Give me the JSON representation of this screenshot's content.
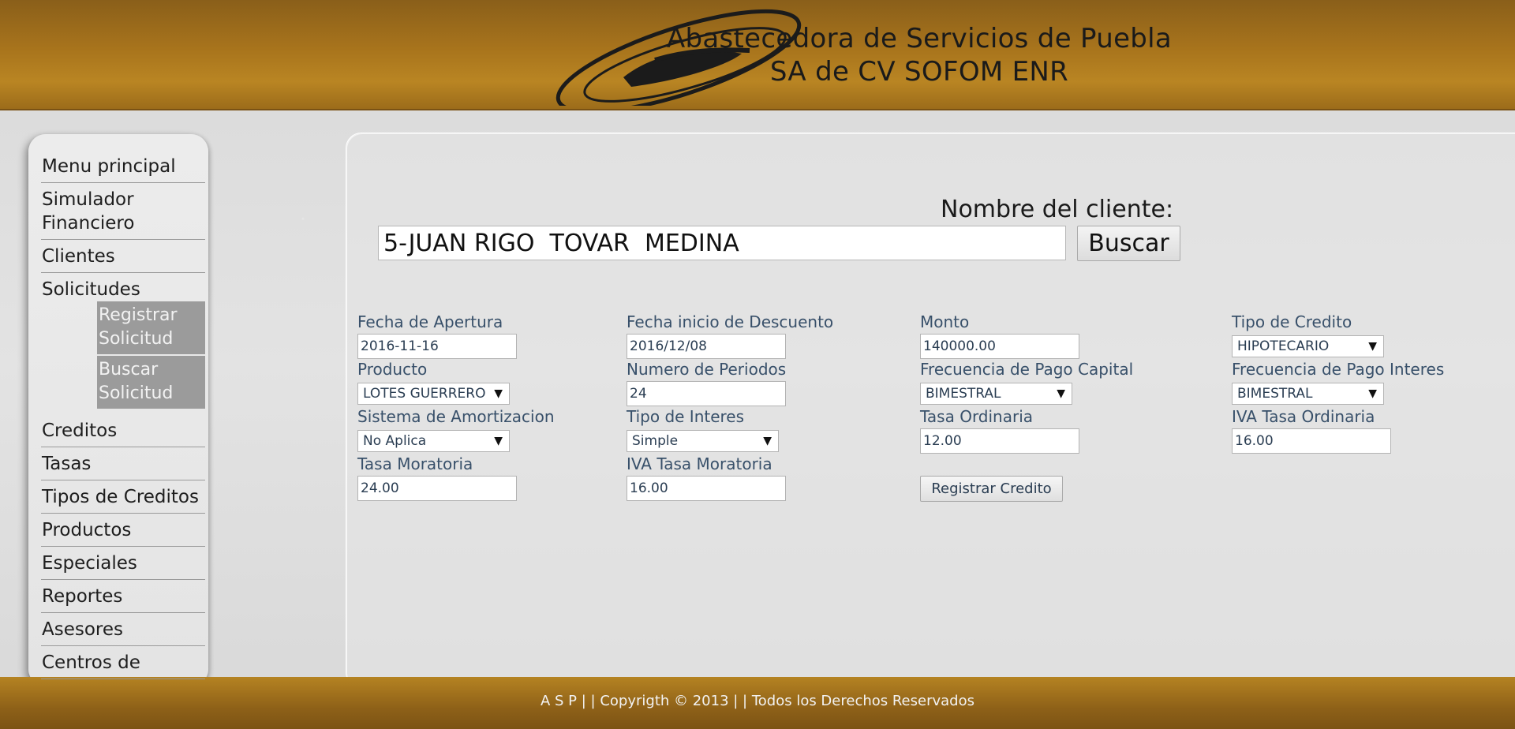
{
  "header": {
    "company_line1": "Abastecedora de Servicios de Puebla",
    "company_line2": "SA de CV SOFOM ENR"
  },
  "sidebar": {
    "items": [
      {
        "label": "Menu principal"
      },
      {
        "label": "Simulador Financiero"
      },
      {
        "label": "Clientes"
      },
      {
        "label": "Solicitudes"
      },
      {
        "label": "Creditos"
      },
      {
        "label": "Tasas"
      },
      {
        "label": "Tipos de Creditos"
      },
      {
        "label": "Productos"
      },
      {
        "label": "Especiales"
      },
      {
        "label": "Reportes"
      },
      {
        "label": "Asesores"
      },
      {
        "label": "Centros de"
      }
    ],
    "subitems": [
      {
        "label": "Registrar Solicitud"
      },
      {
        "label": "Buscar Solicitud"
      }
    ]
  },
  "search": {
    "label": "Nombre del cliente:",
    "value": "5-JUAN RIGO  TOVAR  MEDINA",
    "button_label": "Buscar"
  },
  "form": {
    "fecha_apertura": {
      "label": "Fecha de Apertura",
      "value": "2016-11-16"
    },
    "fecha_inicio": {
      "label": "Fecha inicio de Descuento",
      "value": "2016/12/08"
    },
    "monto": {
      "label": "Monto",
      "value": "140000.00"
    },
    "tipo_credito": {
      "label": "Tipo de Credito",
      "value": "HIPOTECARIO"
    },
    "producto": {
      "label": "Producto",
      "value": "LOTES GUERRERO"
    },
    "numero_periodos": {
      "label": "Numero de Periodos",
      "value": "24"
    },
    "frecuencia_capital": {
      "label": "Frecuencia de Pago Capital",
      "value": "BIMESTRAL"
    },
    "frecuencia_interes": {
      "label": "Frecuencia de Pago Interes",
      "value": "BIMESTRAL"
    },
    "sistema_amortizacion": {
      "label": "Sistema de Amortizacion",
      "value": "No Aplica"
    },
    "tipo_interes": {
      "label": "Tipo de Interes",
      "value": "Simple"
    },
    "tasa_ordinaria": {
      "label": "Tasa Ordinaria",
      "value": "12.00"
    },
    "iva_tasa_ordinaria": {
      "label": "IVA Tasa Ordinaria",
      "value": "16.00"
    },
    "tasa_moratoria": {
      "label": "Tasa Moratoria",
      "value": "24.00"
    },
    "iva_tasa_moratoria": {
      "label": "IVA Tasa Moratoria",
      "value": "16.00"
    },
    "register_button_label": "Registrar Credito"
  },
  "footer": {
    "text": "A S P | | Copyrigth © 2013 | | Todos los Derechos Reservados"
  },
  "icons": {
    "select_arrow": "▼"
  },
  "colors": {
    "header_gold": "#a8741c",
    "label_blue": "#38506a",
    "submenu_gray": "#9b9b9b"
  }
}
